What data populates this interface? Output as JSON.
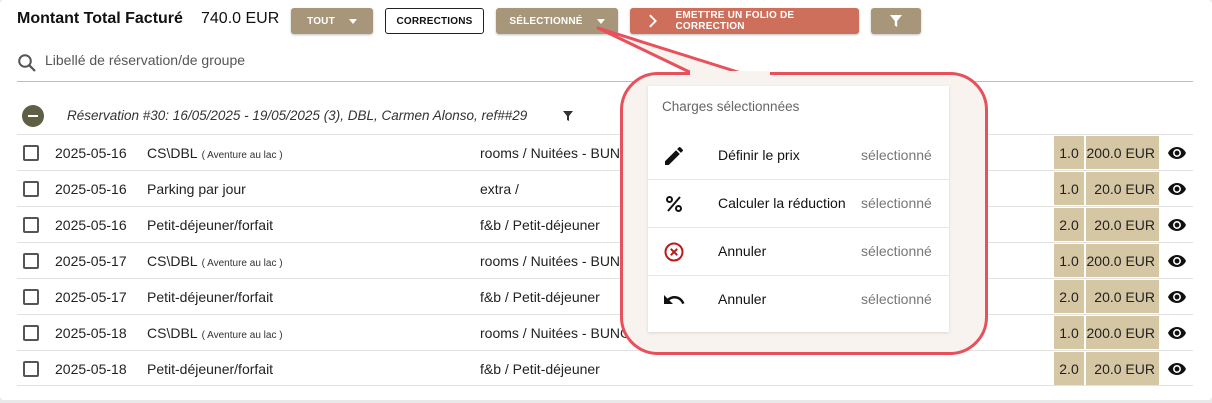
{
  "header": {
    "total_label": "Montant Total Facturé",
    "total_value": "740.0 EUR",
    "btn_all": "TOUT",
    "btn_corrections": "CORRECTIONS",
    "btn_selected": "SÉLECTIONNÉ",
    "btn_emit": "EMETTRE UN FOLIO DE CORRECTION"
  },
  "search": {
    "placeholder": "Libellé de réservation/de groupe"
  },
  "reservation": {
    "title": "Réservation #30: 16/05/2025 - 19/05/2025 (3), DBL, Carmen Alonso, ref##29"
  },
  "rows": [
    {
      "date": "2025-05-16",
      "desc": "CS\\DBL",
      "sub": "( Aventure au lac )",
      "cat": "rooms / Nuitées - BUNGALOW",
      "qty": "1.0",
      "price": "200.0 EUR"
    },
    {
      "date": "2025-05-16",
      "desc": "Parking par jour",
      "sub": "",
      "cat": "extra /",
      "qty": "1.0",
      "price": "20.0 EUR"
    },
    {
      "date": "2025-05-16",
      "desc": "Petit-déjeuner/forfait",
      "sub": "",
      "cat": "f&b / Petit-déjeuner",
      "qty": "2.0",
      "price": "20.0 EUR"
    },
    {
      "date": "2025-05-17",
      "desc": "CS\\DBL",
      "sub": "( Aventure au lac )",
      "cat": "rooms / Nuitées - BUNGALOW",
      "qty": "1.0",
      "price": "200.0 EUR"
    },
    {
      "date": "2025-05-17",
      "desc": "Petit-déjeuner/forfait",
      "sub": "",
      "cat": "f&b / Petit-déjeuner",
      "qty": "2.0",
      "price": "20.0 EUR"
    },
    {
      "date": "2025-05-18",
      "desc": "CS\\DBL",
      "sub": "( Aventure au lac )",
      "cat": "rooms / Nuitées - BUNGALOW",
      "qty": "1.0",
      "price": "200.0 EUR"
    },
    {
      "date": "2025-05-18",
      "desc": "Petit-déjeuner/forfait",
      "sub": "",
      "cat": "f&b / Petit-déjeuner",
      "qty": "2.0",
      "price": "20.0 EUR"
    }
  ],
  "menu": {
    "heading": "Charges sélectionnées",
    "items": [
      {
        "icon": "pencil-icon",
        "label": "Définir le prix",
        "state": "sélectionné"
      },
      {
        "icon": "percent-icon",
        "label": "Calculer la réduction",
        "state": "sélectionné"
      },
      {
        "icon": "cancel-circle-icon",
        "label": "Annuler",
        "state": "sélectionné"
      },
      {
        "icon": "undo-icon",
        "label": "Annuler",
        "state": "sélectionné"
      }
    ]
  },
  "colors": {
    "button_tan": "#a8967a",
    "button_red": "#cd6f5a",
    "price_cell": "#d6c7a4",
    "highlight": "#e8505b",
    "cancel_icon": "#b71c1c"
  }
}
